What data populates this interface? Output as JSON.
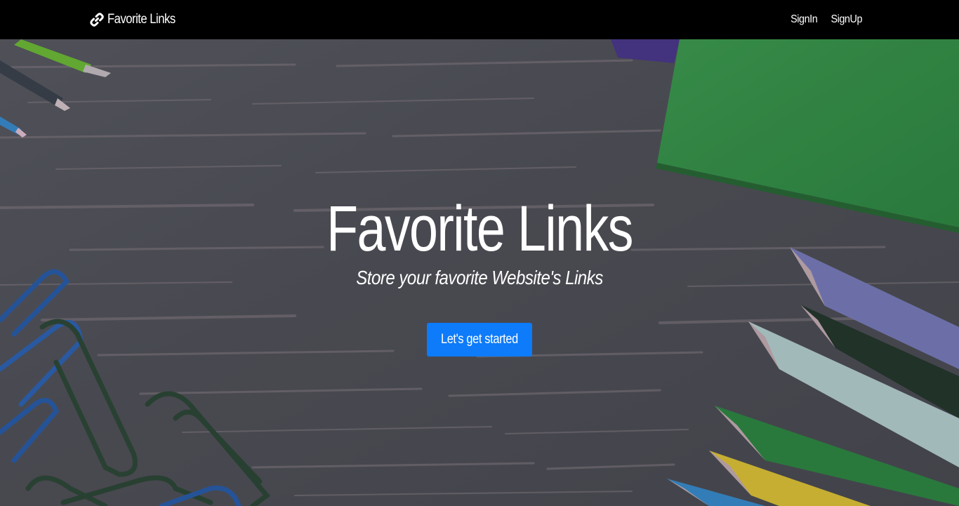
{
  "navbar": {
    "brand": "Favorite Links",
    "brand_icon": "link-icon",
    "links": [
      {
        "label": "SignIn"
      },
      {
        "label": "SignUp"
      }
    ]
  },
  "hero": {
    "title": "Favorite Links",
    "subtitle": "Store your favorite Website's Links",
    "cta_label": "Let's get started"
  },
  "theme": {
    "navbar_bg": "#000000",
    "cta_color": "#0d7bfa",
    "text_color": "#ffffff"
  }
}
